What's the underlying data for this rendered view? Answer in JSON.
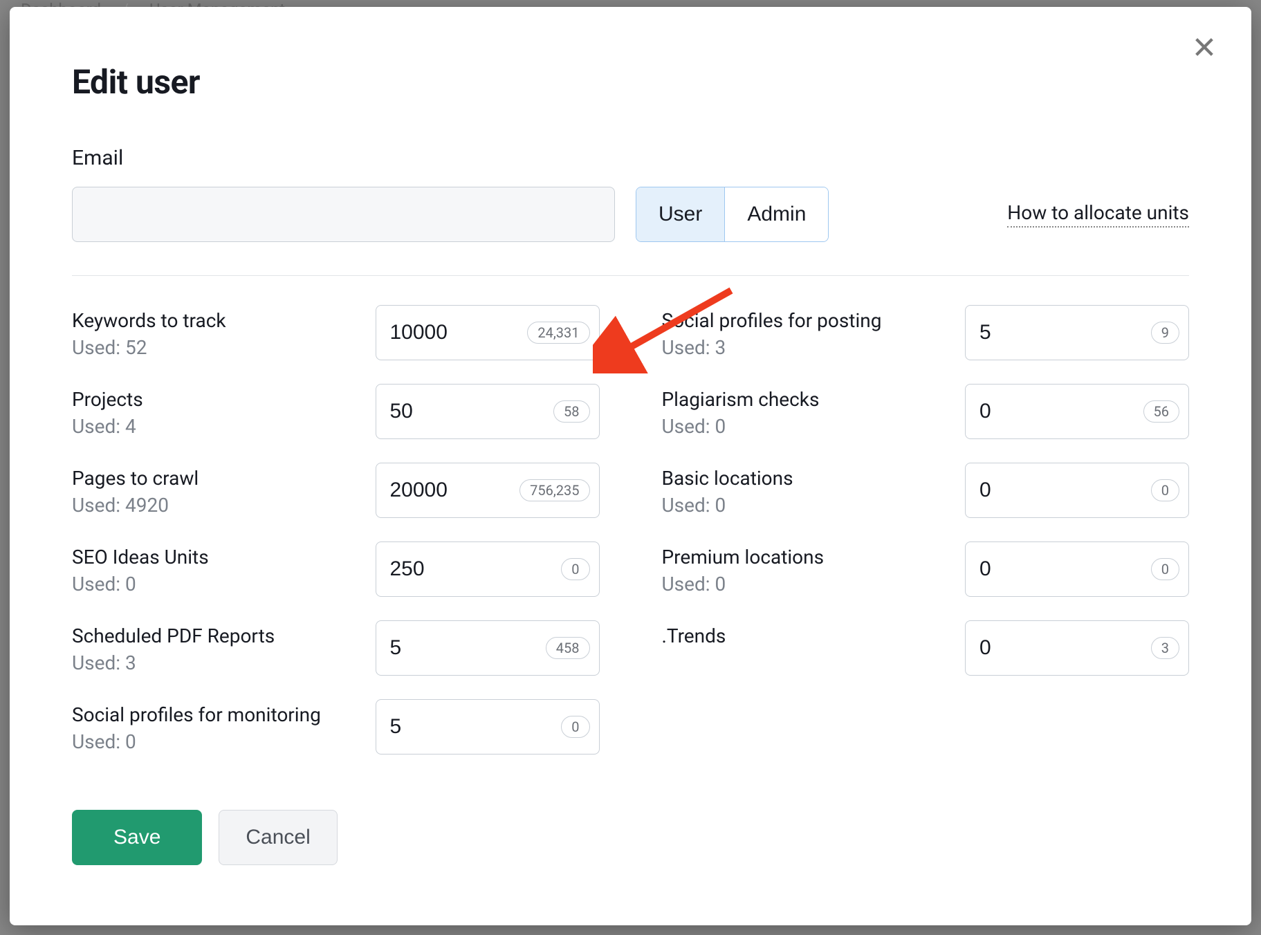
{
  "breadcrumb": {
    "home": "Dashboard",
    "page": "User Management"
  },
  "modal": {
    "title": "Edit user",
    "email_label": "Email",
    "email_value": "",
    "role_user": "User",
    "role_admin": "Admin",
    "role_active": "User",
    "help_link": "How to allocate units",
    "used_prefix": "Used: ",
    "save": "Save",
    "cancel": "Cancel"
  },
  "limits_left": [
    {
      "name": "Keywords to track",
      "used": "52",
      "value": "10000",
      "badge": "24,331"
    },
    {
      "name": "Projects",
      "used": "4",
      "value": "50",
      "badge": "58"
    },
    {
      "name": "Pages to crawl",
      "used": "4920",
      "value": "20000",
      "badge": "756,235"
    },
    {
      "name": "SEO Ideas Units",
      "used": "0",
      "value": "250",
      "badge": "0"
    },
    {
      "name": "Scheduled PDF Reports",
      "used": "3",
      "value": "5",
      "badge": "458"
    },
    {
      "name": "Social profiles for monitoring",
      "used": "0",
      "value": "5",
      "badge": "0"
    }
  ],
  "limits_right": [
    {
      "name": "Social profiles for posting",
      "used": "3",
      "value": "5",
      "badge": "9"
    },
    {
      "name": "Plagiarism checks",
      "used": "0",
      "value": "0",
      "badge": "56"
    },
    {
      "name": "Basic locations",
      "used": "0",
      "value": "0",
      "badge": "0"
    },
    {
      "name": "Premium locations",
      "used": "0",
      "value": "0",
      "badge": "0"
    },
    {
      "name": ".Trends",
      "used": null,
      "value": "0",
      "badge": "3"
    }
  ]
}
